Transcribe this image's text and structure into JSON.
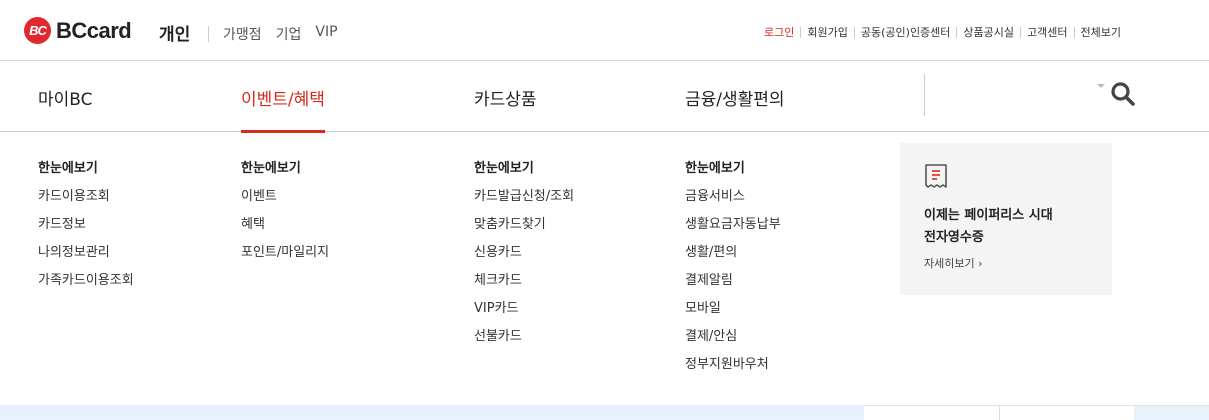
{
  "brand": {
    "mark": "BC",
    "name": "BCcard",
    "accent_color": "#d52b1e"
  },
  "header": {
    "current_segment": "개인",
    "segments": [
      "가맹점",
      "기업",
      "VIP"
    ],
    "util_links": [
      "로그인",
      "회원가입",
      "공동(공인)인증센터",
      "상품공시실",
      "고객센터",
      "전체보기"
    ]
  },
  "gnb": {
    "items": [
      "마이BC",
      "이벤트/혜택",
      "카드상품",
      "금융/생활편의"
    ],
    "active_index": 1,
    "search_icon": "search-icon"
  },
  "mega_menu": {
    "columns": [
      {
        "head": "한눈에보기",
        "links": [
          "카드이용조회",
          "카드정보",
          "나의정보관리",
          "가족카드이용조회"
        ]
      },
      {
        "head": "한눈에보기",
        "links": [
          "이벤트",
          "혜택",
          "포인트/마일리지"
        ]
      },
      {
        "head": "한눈에보기",
        "links": [
          "카드발급신청/조회",
          "맞춤카드찾기",
          "신용카드",
          "체크카드",
          "VIP카드",
          "선불카드"
        ]
      },
      {
        "head": "한눈에보기",
        "links": [
          "금융서비스",
          "생활요금자동납부",
          "생활/편의",
          "결제알림",
          "모바일",
          "결제/안심",
          "정부지원바우처"
        ]
      }
    ],
    "promo": {
      "icon": "receipt-icon",
      "title_line1": "이제는 페이퍼리스 시대",
      "title_line2": "전자영수증",
      "more": "자세히보기 ›"
    }
  }
}
